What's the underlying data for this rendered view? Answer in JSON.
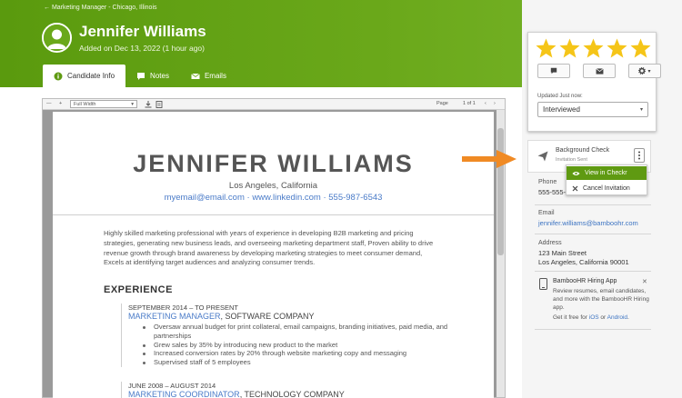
{
  "header": {
    "breadcrumb": "← Marketing Manager - Chicago, Illinois",
    "name": "Jennifer Williams",
    "added": "Added on Dec 13, 2022 (1 hour ago)"
  },
  "tabs": [
    {
      "label": "Candidate Info",
      "icon": "info-icon",
      "active": true
    },
    {
      "label": "Notes",
      "icon": "comment-icon",
      "active": false
    },
    {
      "label": "Emails",
      "icon": "envelope-icon",
      "active": false
    }
  ],
  "viewer": {
    "zoom_out": "—",
    "zoom_in": "+",
    "zoom_select": "Full Width",
    "page_label": "Page",
    "page_of": "1 of 1"
  },
  "resume": {
    "name": "JENNIFER WILLIAMS",
    "location": "Los Angeles, California",
    "contact": "myemail@email.com · www.linkedin.com · 555-987-6543",
    "summary": "Highly skilled marketing professional with years of experience in developing B2B marketing and pricing strategies, generating new business leads, and overseeing marketing department staff, Proven ability to drive revenue growth through brand awareness by developing marketing strategies to meet consumer demand, Excels at identifying target audiences and analyzing consumer trends.",
    "experience_heading": "EXPERIENCE",
    "jobs": [
      {
        "dates": "SEPTEMBER 2014 – TO PRESENT",
        "title": "MARKETING MANAGER",
        "company": ", SOFTWARE COMPANY",
        "bullets": [
          "Oversaw annual budget for print collateral, email campaigns, branding initiatives, paid media, and partnerships",
          "Grew sales by 35% by introducing new product to the market",
          "Increased conversion rates by 20% through website marketing copy and messaging",
          "Supervised staff of 5 employees"
        ]
      },
      {
        "dates": "JUNE 2008 – AUGUST 2014",
        "title": "MARKETING COORDINATOR",
        "company": ", TECHNOLOGY COMPANY",
        "bullets": []
      }
    ]
  },
  "rating": {
    "stars": 5,
    "star_color": "#f5c518",
    "updated_label": "Updated Just now:",
    "status": "Interviewed"
  },
  "background_check": {
    "title": "Background Check",
    "subtitle": "Invitation Sent",
    "menu": [
      {
        "label": "View in Checkr",
        "icon": "eye-icon"
      },
      {
        "label": "Cancel Invitation",
        "icon": "x-icon"
      }
    ]
  },
  "contact": {
    "phone_label": "Phone",
    "phone": "555-555-",
    "email_label": "Email",
    "email": "jennifer.williams@bamboohr.com",
    "address_label": "Address",
    "address_line1": "123 Main Street",
    "address_line2": "Los Angeles, California 90001"
  },
  "app_promo": {
    "title": "BambooHR Hiring App",
    "description": "Review resumes, email candidates, and more with the BambooHR Hiring app.",
    "get_prefix": "Get it free for ",
    "ios": "iOS",
    "or": " or ",
    "android": "Android",
    "suffix": "."
  },
  "colors": {
    "brand_green": "#6aa81a",
    "link_blue": "#3d74c2",
    "arrow_orange": "#f08a24"
  }
}
